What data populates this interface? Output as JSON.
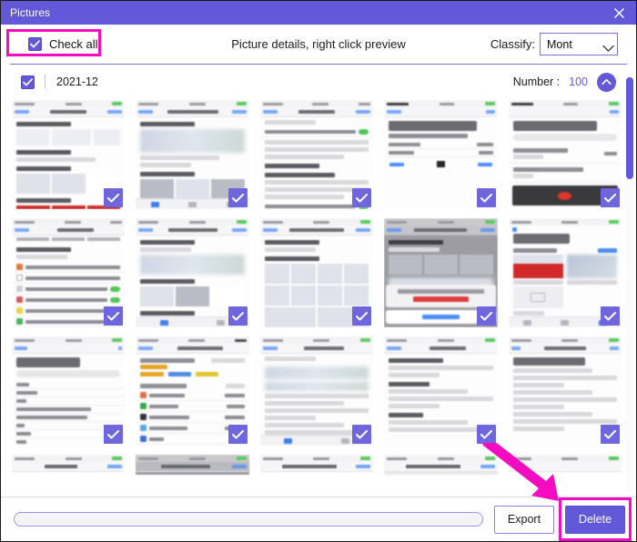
{
  "window": {
    "title": "Pictures",
    "close_icon": "close-icon"
  },
  "toolbar": {
    "check_all_label": "Check all",
    "check_all_checked": true,
    "hint_text": "Picture details, right click preview",
    "classify_label": "Classify:",
    "classify_value": "Mont",
    "classify_options": [
      "Mont"
    ],
    "chevron_icon": "chevron-down-icon"
  },
  "group": {
    "checked": true,
    "date": "2021-12",
    "number_label": "Number :",
    "number_value": "100",
    "collapse_icon": "chevron-up-icon"
  },
  "grid": {
    "thumbnails": [
      {
        "caption": "",
        "selected": true,
        "kind": "settings-detail"
      },
      {
        "caption": "",
        "selected": true,
        "kind": "photos-blur"
      },
      {
        "caption": "",
        "selected": true,
        "kind": "settings-toggles"
      },
      {
        "caption": "Recently Deleted",
        "selected": true,
        "kind": "recently-deleted"
      },
      {
        "caption": "Voice Memos",
        "selected": true,
        "kind": "voice-memos"
      },
      {
        "caption": "",
        "selected": true,
        "kind": "settings-list-toggles"
      },
      {
        "caption": "",
        "selected": true,
        "kind": "photos-detail"
      },
      {
        "caption": "",
        "selected": true,
        "kind": "photos-grid"
      },
      {
        "caption": "",
        "selected": true,
        "kind": "delete-sheet"
      },
      {
        "caption": "Albums",
        "selected": true,
        "kind": "albums"
      },
      {
        "caption": "Contacts",
        "selected": true,
        "kind": "contacts"
      },
      {
        "caption": "",
        "selected": true,
        "kind": "storage"
      },
      {
        "caption": "",
        "selected": true,
        "kind": "text-doc"
      },
      {
        "caption": "",
        "selected": true,
        "kind": "settings-plain"
      },
      {
        "caption": "",
        "selected": true,
        "kind": "messages"
      }
    ]
  },
  "scrollbar": {
    "orientation": "vertical"
  },
  "footer": {
    "progress_value": 0,
    "export_label": "Export",
    "delete_label": "Delete"
  },
  "annotations": {
    "highlight_color": "#f50cc0",
    "arrow_color": "#f50cc0",
    "accent_color": "#6258d8"
  }
}
